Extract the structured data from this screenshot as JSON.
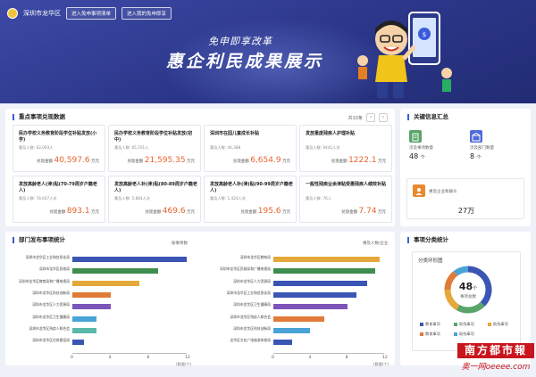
{
  "header": {
    "city": "深圳市龙华区",
    "nav": [
      "进入免申事项清单",
      "进入我的免申即享"
    ],
    "slogan": "免申即享改革",
    "title": "惠企利民成果展示"
  },
  "key_items": {
    "title": "重点事项兑现数据",
    "pager": "共10条",
    "prev": "‹",
    "next": "›",
    "count_prefix": "惠及人数:",
    "amount_prefix": "兑现金额",
    "unit": "万元",
    "cards": [
      {
        "name": "民办学校义务教育阶段学位补贴发放(小学)",
        "people": "63,093人",
        "amount": "40,597.6"
      },
      {
        "name": "民办学校义务教育阶段学位补贴发放(初中)",
        "people": "65,701人",
        "amount": "21,595.35"
      },
      {
        "name": "深圳市在园儿童成长补贴",
        "people": "44,388",
        "amount": "6,654.9"
      },
      {
        "name": "发放重度残疾人护理补贴",
        "people": "9441人次",
        "amount": "1222.1"
      },
      {
        "name": "发放高龄老人(津)贴(70-79周岁户籍老人)",
        "people": "78,647人次",
        "amount": "893.1"
      },
      {
        "name": "发放高龄老人补(津)贴(80-89周岁户籍老人)",
        "people": "5,884人次",
        "amount": "469.6"
      },
      {
        "name": "发放高龄老人补(津)贴(90-99周岁户籍老人)",
        "people": "1,424人次",
        "amount": "195.6"
      },
      {
        "name": "一般性残疾业余津贴受惠残疾人绩效补贴",
        "people": "76人",
        "amount": "7.74"
      }
    ]
  },
  "key_info": {
    "title": "关键信息汇总",
    "items": [
      {
        "label": "涉及事项数量",
        "value": "48",
        "unit": "个",
        "color": "#5aa469",
        "icon": "document-icon"
      },
      {
        "label": "涉及部门数量",
        "value": "8",
        "unit": "个",
        "color": "#4f6bd8",
        "icon": "department-icon"
      },
      {
        "label": "惠及企业和群众",
        "value": "27万",
        "unit": "",
        "color": "#e8892c",
        "icon": "people-icon"
      }
    ]
  },
  "dept": {
    "title": "部门发布事项统计",
    "left_sub": "按事项数",
    "right_sub": "惠及人数/企业",
    "unit": "(数量/个)",
    "ticks": [
      "0",
      "4",
      "8",
      "12"
    ]
  },
  "chart_data": [
    {
      "type": "bar",
      "orientation": "horizontal",
      "categories": [
        "深圳市龙华区工业和信息化局",
        "深圳市龙华区民政局",
        "深圳市龙华区教育局和广播电视局",
        "深圳市龙华区科技创新局",
        "深圳市龙华区人力资源局",
        "深圳市龙华区卫生健康局",
        "深圳市龙华区残疾人联合会",
        "深圳市龙华区住房建设局"
      ],
      "values": [
        13,
        9,
        7,
        4,
        4,
        2.5,
        2.5,
        1.2
      ],
      "colors": [
        "#3a55b4",
        "#3e8e4f",
        "#e5a83a",
        "#e07b39",
        "#7c55b9",
        "#49a3d6",
        "#58b9a8",
        "#3a55b4"
      ],
      "xlim": [
        0,
        12
      ],
      "xticks": [
        0,
        4,
        8,
        12
      ],
      "xlabel": "(数量/个)"
    },
    {
      "type": "bar",
      "orientation": "horizontal",
      "categories": [
        "深圳市龙华区教育局",
        "深圳市龙华区民政局和广播电视局",
        "深圳市龙华区人力资源局",
        "深圳市龙华区工业和信息化局",
        "深圳市龙华区卫生健康局",
        "深圳市龙华区残疾人联合会",
        "深圳市龙华区科技创新局",
        "龙华区文化广电旅游体育局"
      ],
      "values": [
        11.5,
        11,
        10.2,
        9,
        8,
        5.5,
        4,
        2
      ],
      "colors": [
        "#e5a83a",
        "#3e8e4f",
        "#3a55b4",
        "#3a55b4",
        "#7c55b9",
        "#e07b39",
        "#49a3d6",
        "#3a55b4"
      ],
      "xlim": [
        0,
        12
      ],
      "xticks": [
        0,
        4,
        8,
        12
      ],
      "xlabel": "(数量/个)"
    },
    {
      "type": "pie",
      "title": "分类环形图",
      "center_value": "48",
      "center_unit": "个",
      "center_label": "事项总数",
      "slices": [
        {
          "name": "教育事项",
          "value": 18,
          "color": "#3a55b4"
        },
        {
          "name": "助残事项",
          "value": 10,
          "color": "#5aa469"
        },
        {
          "name": "助残事项",
          "value": 8,
          "color": "#e5a83a"
        },
        {
          "name": "教育事项",
          "value": 7,
          "color": "#e07b39"
        },
        {
          "name": "助残事项",
          "value": 5,
          "color": "#49a3d6"
        }
      ]
    }
  ],
  "category": {
    "title": "事项分类统计"
  },
  "watermark": {
    "line1": "南方都市報",
    "line2": "奥一网oeeee.com"
  }
}
